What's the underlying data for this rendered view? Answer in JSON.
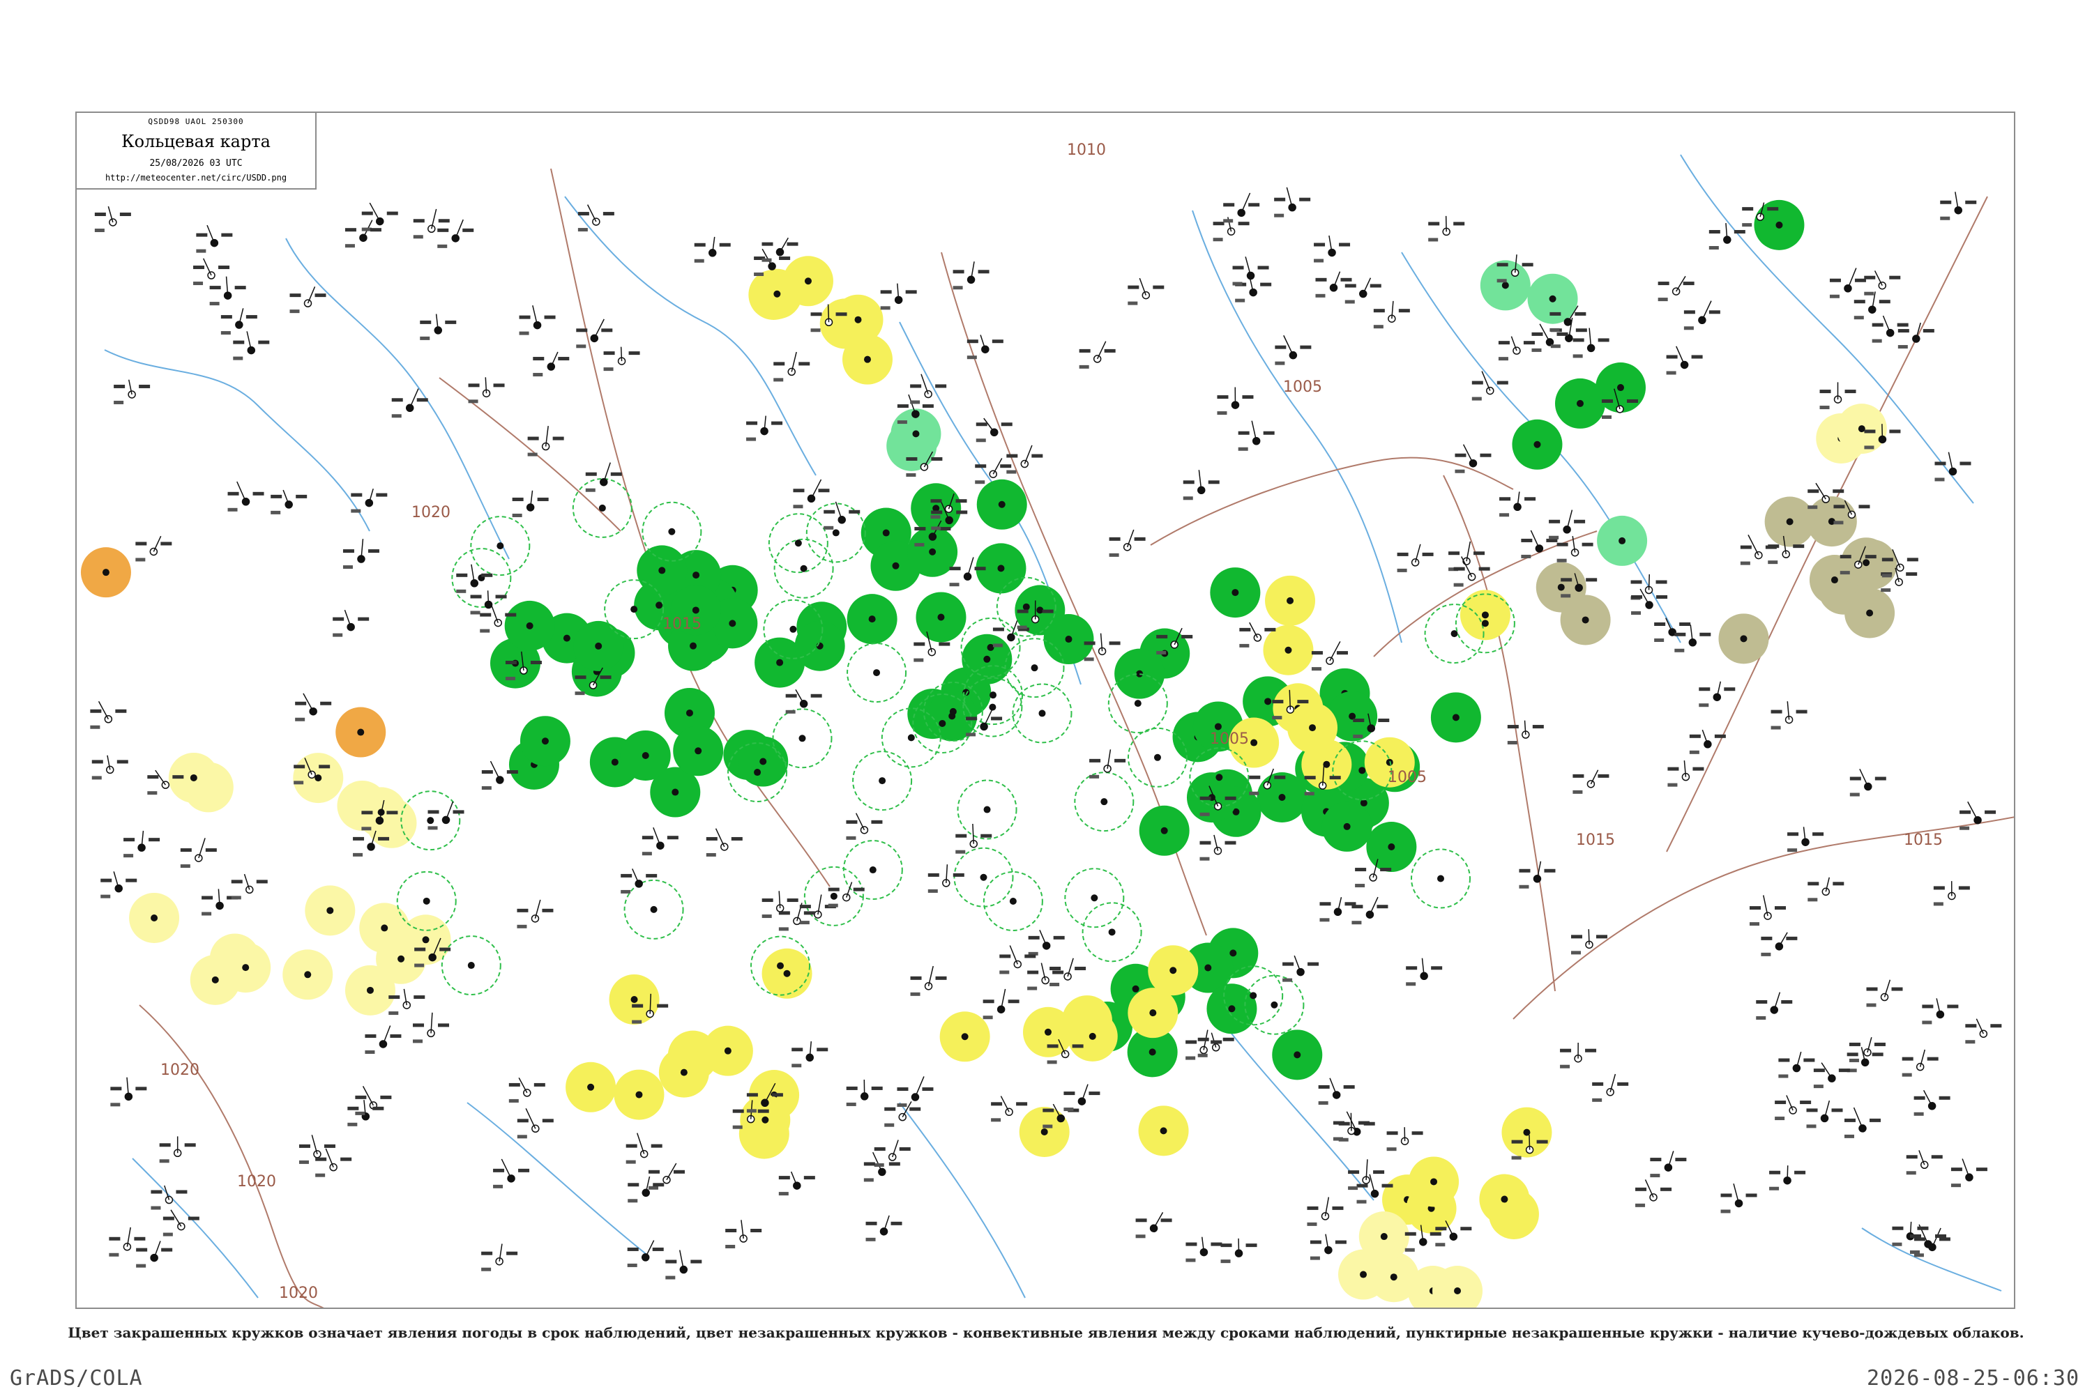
{
  "legend": {
    "code_line": "QSDD98 UAOL 250300",
    "title": "Кольцевая карта",
    "datetime": "25/08/2026 03 UTC",
    "url": "http://meteocenter.net/circ/USDD.png"
  },
  "isobars": [
    {
      "label": "1010"
    },
    {
      "label": "1005"
    },
    {
      "label": "1015"
    },
    {
      "label": "1020"
    }
  ],
  "colors": {
    "isobar": "#b07a6a",
    "river": "#6aaee0",
    "station_green": "#11b830",
    "station_light_green": "#72e39a",
    "station_yellow": "#f5f05a",
    "station_pale_yellow": "#fbf7a6",
    "station_olive": "#bfbc92",
    "station_orange": "#f0a845",
    "dashed_ring": "#2fbf4a"
  },
  "station_classes": [
    "green",
    "light_green",
    "yellow",
    "pale_yellow",
    "olive",
    "orange",
    "ring"
  ],
  "caption": "Цвет закрашенных кружков означает явления погоды в срок наблюдений, цвет незакрашенных кружков - конвективные явления между сроками наблюдений, пунктирные незакрашенные кружки - наличие кучево-дождевых облаков.",
  "footer": {
    "left": "GrADS/COLA",
    "right": "2026-08-25-06:30"
  }
}
